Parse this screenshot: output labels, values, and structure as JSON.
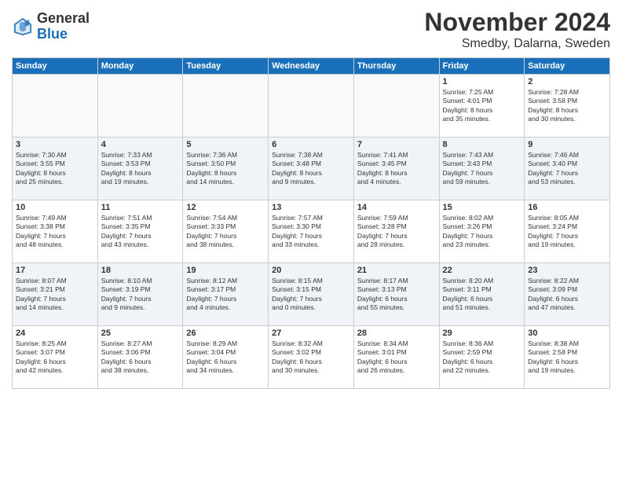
{
  "logo": {
    "general": "General",
    "blue": "Blue"
  },
  "title": "November 2024",
  "location": "Smedby, Dalarna, Sweden",
  "days_of_week": [
    "Sunday",
    "Monday",
    "Tuesday",
    "Wednesday",
    "Thursday",
    "Friday",
    "Saturday"
  ],
  "weeks": [
    [
      {
        "day": "",
        "info": ""
      },
      {
        "day": "",
        "info": ""
      },
      {
        "day": "",
        "info": ""
      },
      {
        "day": "",
        "info": ""
      },
      {
        "day": "",
        "info": ""
      },
      {
        "day": "1",
        "info": "Sunrise: 7:25 AM\nSunset: 4:01 PM\nDaylight: 8 hours\nand 35 minutes."
      },
      {
        "day": "2",
        "info": "Sunrise: 7:28 AM\nSunset: 3:58 PM\nDaylight: 8 hours\nand 30 minutes."
      }
    ],
    [
      {
        "day": "3",
        "info": "Sunrise: 7:30 AM\nSunset: 3:55 PM\nDaylight: 8 hours\nand 25 minutes."
      },
      {
        "day": "4",
        "info": "Sunrise: 7:33 AM\nSunset: 3:53 PM\nDaylight: 8 hours\nand 19 minutes."
      },
      {
        "day": "5",
        "info": "Sunrise: 7:36 AM\nSunset: 3:50 PM\nDaylight: 8 hours\nand 14 minutes."
      },
      {
        "day": "6",
        "info": "Sunrise: 7:38 AM\nSunset: 3:48 PM\nDaylight: 8 hours\nand 9 minutes."
      },
      {
        "day": "7",
        "info": "Sunrise: 7:41 AM\nSunset: 3:45 PM\nDaylight: 8 hours\nand 4 minutes."
      },
      {
        "day": "8",
        "info": "Sunrise: 7:43 AM\nSunset: 3:43 PM\nDaylight: 7 hours\nand 59 minutes."
      },
      {
        "day": "9",
        "info": "Sunrise: 7:46 AM\nSunset: 3:40 PM\nDaylight: 7 hours\nand 53 minutes."
      }
    ],
    [
      {
        "day": "10",
        "info": "Sunrise: 7:49 AM\nSunset: 3:38 PM\nDaylight: 7 hours\nand 48 minutes."
      },
      {
        "day": "11",
        "info": "Sunrise: 7:51 AM\nSunset: 3:35 PM\nDaylight: 7 hours\nand 43 minutes."
      },
      {
        "day": "12",
        "info": "Sunrise: 7:54 AM\nSunset: 3:33 PM\nDaylight: 7 hours\nand 38 minutes."
      },
      {
        "day": "13",
        "info": "Sunrise: 7:57 AM\nSunset: 3:30 PM\nDaylight: 7 hours\nand 33 minutes."
      },
      {
        "day": "14",
        "info": "Sunrise: 7:59 AM\nSunset: 3:28 PM\nDaylight: 7 hours\nand 28 minutes."
      },
      {
        "day": "15",
        "info": "Sunrise: 8:02 AM\nSunset: 3:26 PM\nDaylight: 7 hours\nand 23 minutes."
      },
      {
        "day": "16",
        "info": "Sunrise: 8:05 AM\nSunset: 3:24 PM\nDaylight: 7 hours\nand 19 minutes."
      }
    ],
    [
      {
        "day": "17",
        "info": "Sunrise: 8:07 AM\nSunset: 3:21 PM\nDaylight: 7 hours\nand 14 minutes."
      },
      {
        "day": "18",
        "info": "Sunrise: 8:10 AM\nSunset: 3:19 PM\nDaylight: 7 hours\nand 9 minutes."
      },
      {
        "day": "19",
        "info": "Sunrise: 8:12 AM\nSunset: 3:17 PM\nDaylight: 7 hours\nand 4 minutes."
      },
      {
        "day": "20",
        "info": "Sunrise: 8:15 AM\nSunset: 3:15 PM\nDaylight: 7 hours\nand 0 minutes."
      },
      {
        "day": "21",
        "info": "Sunrise: 8:17 AM\nSunset: 3:13 PM\nDaylight: 6 hours\nand 55 minutes."
      },
      {
        "day": "22",
        "info": "Sunrise: 8:20 AM\nSunset: 3:11 PM\nDaylight: 6 hours\nand 51 minutes."
      },
      {
        "day": "23",
        "info": "Sunrise: 8:22 AM\nSunset: 3:09 PM\nDaylight: 6 hours\nand 47 minutes."
      }
    ],
    [
      {
        "day": "24",
        "info": "Sunrise: 8:25 AM\nSunset: 3:07 PM\nDaylight: 6 hours\nand 42 minutes."
      },
      {
        "day": "25",
        "info": "Sunrise: 8:27 AM\nSunset: 3:06 PM\nDaylight: 6 hours\nand 38 minutes."
      },
      {
        "day": "26",
        "info": "Sunrise: 8:29 AM\nSunset: 3:04 PM\nDaylight: 6 hours\nand 34 minutes."
      },
      {
        "day": "27",
        "info": "Sunrise: 8:32 AM\nSunset: 3:02 PM\nDaylight: 6 hours\nand 30 minutes."
      },
      {
        "day": "28",
        "info": "Sunrise: 8:34 AM\nSunset: 3:01 PM\nDaylight: 6 hours\nand 26 minutes."
      },
      {
        "day": "29",
        "info": "Sunrise: 8:36 AM\nSunset: 2:59 PM\nDaylight: 6 hours\nand 22 minutes."
      },
      {
        "day": "30",
        "info": "Sunrise: 8:38 AM\nSunset: 2:58 PM\nDaylight: 6 hours\nand 19 minutes."
      }
    ]
  ]
}
